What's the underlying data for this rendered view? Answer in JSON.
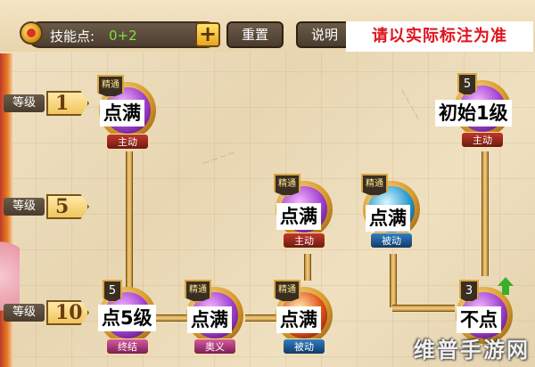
{
  "topbar": {
    "points_label": "技能点:",
    "points_value": "0+2",
    "add_label": "+",
    "reset_label": "重置",
    "help_label": "说明",
    "notice": "请以实际标注为准"
  },
  "levels": [
    {
      "label": "等级",
      "value": "1"
    },
    {
      "label": "等级",
      "value": "5"
    },
    {
      "label": "等级",
      "value": "10"
    }
  ],
  "skills": [
    {
      "badge": "精通",
      "type": "主动",
      "annotation": "点满"
    },
    {
      "badge": "5",
      "type": "主动",
      "annotation": "初始1级"
    },
    {
      "badge": "精通",
      "type": "主动",
      "annotation": "点满"
    },
    {
      "badge": "精通",
      "type": "被动",
      "annotation": "点满"
    },
    {
      "badge": "5",
      "type": "终结",
      "annotation": "点5级"
    },
    {
      "badge": "精通",
      "type": "奥义",
      "annotation": "点满"
    },
    {
      "badge": "精通",
      "type": "被动",
      "annotation": "点满"
    },
    {
      "badge": "3",
      "type": "",
      "annotation": "不点"
    }
  ],
  "watermark": "维普手游网",
  "colors": {
    "points_value": "#7ee13a",
    "notice": "#e0141e",
    "active": "#c0392b",
    "passive": "#2e7fc4"
  }
}
